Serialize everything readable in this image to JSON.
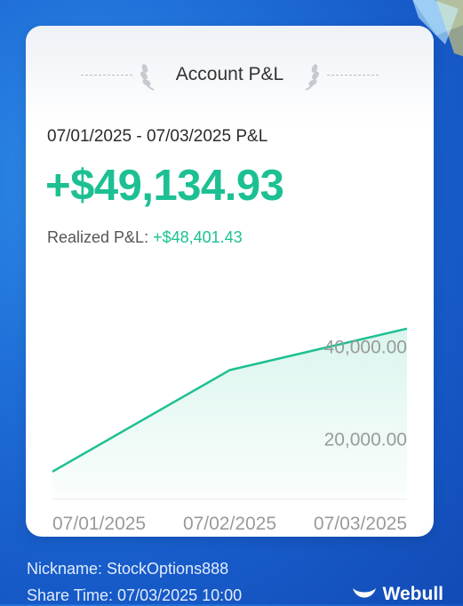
{
  "header": {
    "title": "Account P&L"
  },
  "summary": {
    "period": "07/01/2025 - 07/03/2025 P&L",
    "total_pnl": "+$49,134.93",
    "realized_label": "Realized P&L: ",
    "realized_value": "+$48,401.43"
  },
  "chart_data": {
    "type": "area",
    "x": [
      "07/01/2025",
      "07/02/2025",
      "07/03/2025"
    ],
    "values": [
      13000,
      35000,
      44000
    ],
    "y_ticks": [
      "40,000.00",
      "20,000.00"
    ],
    "y_tick_values": [
      40000,
      20000
    ],
    "ylim": [
      7000,
      48000
    ],
    "grid": false,
    "color": "#1dc093"
  },
  "footer": {
    "nickname": "Nickname: StockOptions888",
    "share_time": "Share Time: 07/03/2025 10:00"
  },
  "brand": {
    "name": "Webull",
    "icon": "webull-logo-icon"
  },
  "colors": {
    "accent": "#1dc093",
    "background": "#1f6fd8"
  }
}
